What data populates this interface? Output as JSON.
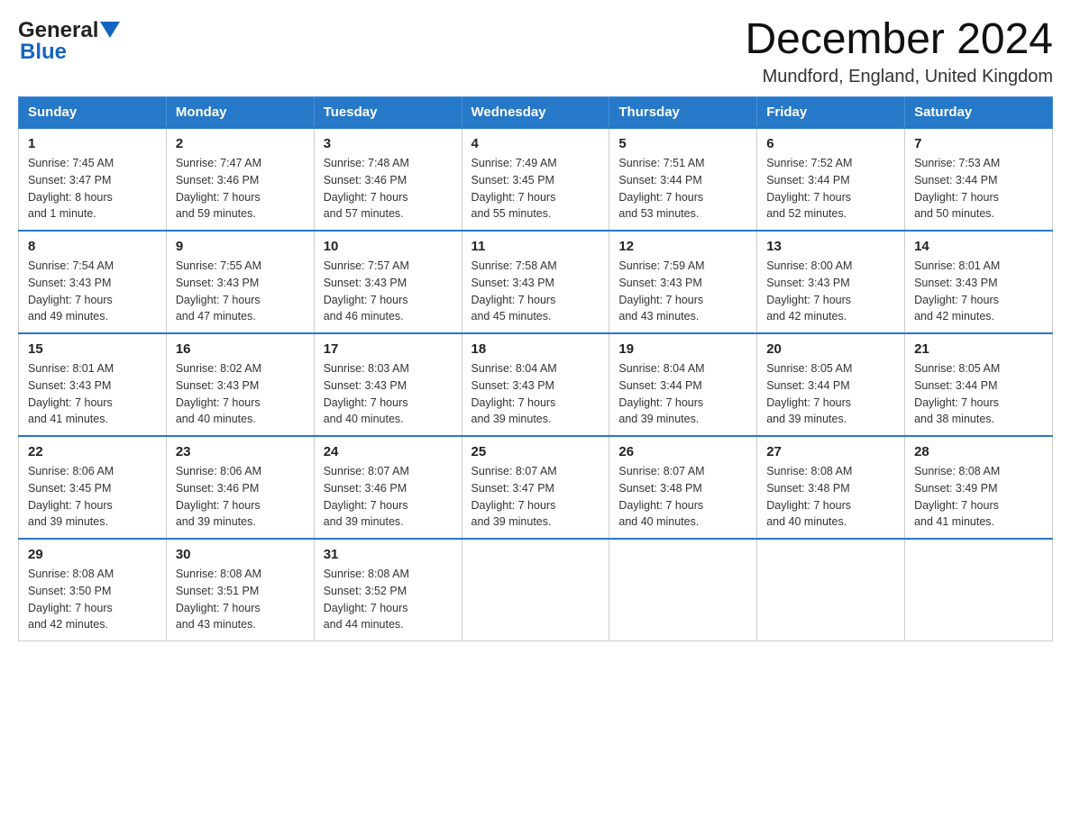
{
  "header": {
    "logo_general": "General",
    "logo_blue": "Blue",
    "month_title": "December 2024",
    "location": "Mundford, England, United Kingdom"
  },
  "days_of_week": [
    "Sunday",
    "Monday",
    "Tuesday",
    "Wednesday",
    "Thursday",
    "Friday",
    "Saturday"
  ],
  "weeks": [
    [
      {
        "day": "1",
        "sunrise": "Sunrise: 7:45 AM",
        "sunset": "Sunset: 3:47 PM",
        "daylight": "Daylight: 8 hours",
        "daylight2": "and 1 minute."
      },
      {
        "day": "2",
        "sunrise": "Sunrise: 7:47 AM",
        "sunset": "Sunset: 3:46 PM",
        "daylight": "Daylight: 7 hours",
        "daylight2": "and 59 minutes."
      },
      {
        "day": "3",
        "sunrise": "Sunrise: 7:48 AM",
        "sunset": "Sunset: 3:46 PM",
        "daylight": "Daylight: 7 hours",
        "daylight2": "and 57 minutes."
      },
      {
        "day": "4",
        "sunrise": "Sunrise: 7:49 AM",
        "sunset": "Sunset: 3:45 PM",
        "daylight": "Daylight: 7 hours",
        "daylight2": "and 55 minutes."
      },
      {
        "day": "5",
        "sunrise": "Sunrise: 7:51 AM",
        "sunset": "Sunset: 3:44 PM",
        "daylight": "Daylight: 7 hours",
        "daylight2": "and 53 minutes."
      },
      {
        "day": "6",
        "sunrise": "Sunrise: 7:52 AM",
        "sunset": "Sunset: 3:44 PM",
        "daylight": "Daylight: 7 hours",
        "daylight2": "and 52 minutes."
      },
      {
        "day": "7",
        "sunrise": "Sunrise: 7:53 AM",
        "sunset": "Sunset: 3:44 PM",
        "daylight": "Daylight: 7 hours",
        "daylight2": "and 50 minutes."
      }
    ],
    [
      {
        "day": "8",
        "sunrise": "Sunrise: 7:54 AM",
        "sunset": "Sunset: 3:43 PM",
        "daylight": "Daylight: 7 hours",
        "daylight2": "and 49 minutes."
      },
      {
        "day": "9",
        "sunrise": "Sunrise: 7:55 AM",
        "sunset": "Sunset: 3:43 PM",
        "daylight": "Daylight: 7 hours",
        "daylight2": "and 47 minutes."
      },
      {
        "day": "10",
        "sunrise": "Sunrise: 7:57 AM",
        "sunset": "Sunset: 3:43 PM",
        "daylight": "Daylight: 7 hours",
        "daylight2": "and 46 minutes."
      },
      {
        "day": "11",
        "sunrise": "Sunrise: 7:58 AM",
        "sunset": "Sunset: 3:43 PM",
        "daylight": "Daylight: 7 hours",
        "daylight2": "and 45 minutes."
      },
      {
        "day": "12",
        "sunrise": "Sunrise: 7:59 AM",
        "sunset": "Sunset: 3:43 PM",
        "daylight": "Daylight: 7 hours",
        "daylight2": "and 43 minutes."
      },
      {
        "day": "13",
        "sunrise": "Sunrise: 8:00 AM",
        "sunset": "Sunset: 3:43 PM",
        "daylight": "Daylight: 7 hours",
        "daylight2": "and 42 minutes."
      },
      {
        "day": "14",
        "sunrise": "Sunrise: 8:01 AM",
        "sunset": "Sunset: 3:43 PM",
        "daylight": "Daylight: 7 hours",
        "daylight2": "and 42 minutes."
      }
    ],
    [
      {
        "day": "15",
        "sunrise": "Sunrise: 8:01 AM",
        "sunset": "Sunset: 3:43 PM",
        "daylight": "Daylight: 7 hours",
        "daylight2": "and 41 minutes."
      },
      {
        "day": "16",
        "sunrise": "Sunrise: 8:02 AM",
        "sunset": "Sunset: 3:43 PM",
        "daylight": "Daylight: 7 hours",
        "daylight2": "and 40 minutes."
      },
      {
        "day": "17",
        "sunrise": "Sunrise: 8:03 AM",
        "sunset": "Sunset: 3:43 PM",
        "daylight": "Daylight: 7 hours",
        "daylight2": "and 40 minutes."
      },
      {
        "day": "18",
        "sunrise": "Sunrise: 8:04 AM",
        "sunset": "Sunset: 3:43 PM",
        "daylight": "Daylight: 7 hours",
        "daylight2": "and 39 minutes."
      },
      {
        "day": "19",
        "sunrise": "Sunrise: 8:04 AM",
        "sunset": "Sunset: 3:44 PM",
        "daylight": "Daylight: 7 hours",
        "daylight2": "and 39 minutes."
      },
      {
        "day": "20",
        "sunrise": "Sunrise: 8:05 AM",
        "sunset": "Sunset: 3:44 PM",
        "daylight": "Daylight: 7 hours",
        "daylight2": "and 39 minutes."
      },
      {
        "day": "21",
        "sunrise": "Sunrise: 8:05 AM",
        "sunset": "Sunset: 3:44 PM",
        "daylight": "Daylight: 7 hours",
        "daylight2": "and 38 minutes."
      }
    ],
    [
      {
        "day": "22",
        "sunrise": "Sunrise: 8:06 AM",
        "sunset": "Sunset: 3:45 PM",
        "daylight": "Daylight: 7 hours",
        "daylight2": "and 39 minutes."
      },
      {
        "day": "23",
        "sunrise": "Sunrise: 8:06 AM",
        "sunset": "Sunset: 3:46 PM",
        "daylight": "Daylight: 7 hours",
        "daylight2": "and 39 minutes."
      },
      {
        "day": "24",
        "sunrise": "Sunrise: 8:07 AM",
        "sunset": "Sunset: 3:46 PM",
        "daylight": "Daylight: 7 hours",
        "daylight2": "and 39 minutes."
      },
      {
        "day": "25",
        "sunrise": "Sunrise: 8:07 AM",
        "sunset": "Sunset: 3:47 PM",
        "daylight": "Daylight: 7 hours",
        "daylight2": "and 39 minutes."
      },
      {
        "day": "26",
        "sunrise": "Sunrise: 8:07 AM",
        "sunset": "Sunset: 3:48 PM",
        "daylight": "Daylight: 7 hours",
        "daylight2": "and 40 minutes."
      },
      {
        "day": "27",
        "sunrise": "Sunrise: 8:08 AM",
        "sunset": "Sunset: 3:48 PM",
        "daylight": "Daylight: 7 hours",
        "daylight2": "and 40 minutes."
      },
      {
        "day": "28",
        "sunrise": "Sunrise: 8:08 AM",
        "sunset": "Sunset: 3:49 PM",
        "daylight": "Daylight: 7 hours",
        "daylight2": "and 41 minutes."
      }
    ],
    [
      {
        "day": "29",
        "sunrise": "Sunrise: 8:08 AM",
        "sunset": "Sunset: 3:50 PM",
        "daylight": "Daylight: 7 hours",
        "daylight2": "and 42 minutes."
      },
      {
        "day": "30",
        "sunrise": "Sunrise: 8:08 AM",
        "sunset": "Sunset: 3:51 PM",
        "daylight": "Daylight: 7 hours",
        "daylight2": "and 43 minutes."
      },
      {
        "day": "31",
        "sunrise": "Sunrise: 8:08 AM",
        "sunset": "Sunset: 3:52 PM",
        "daylight": "Daylight: 7 hours",
        "daylight2": "and 44 minutes."
      },
      null,
      null,
      null,
      null
    ]
  ]
}
